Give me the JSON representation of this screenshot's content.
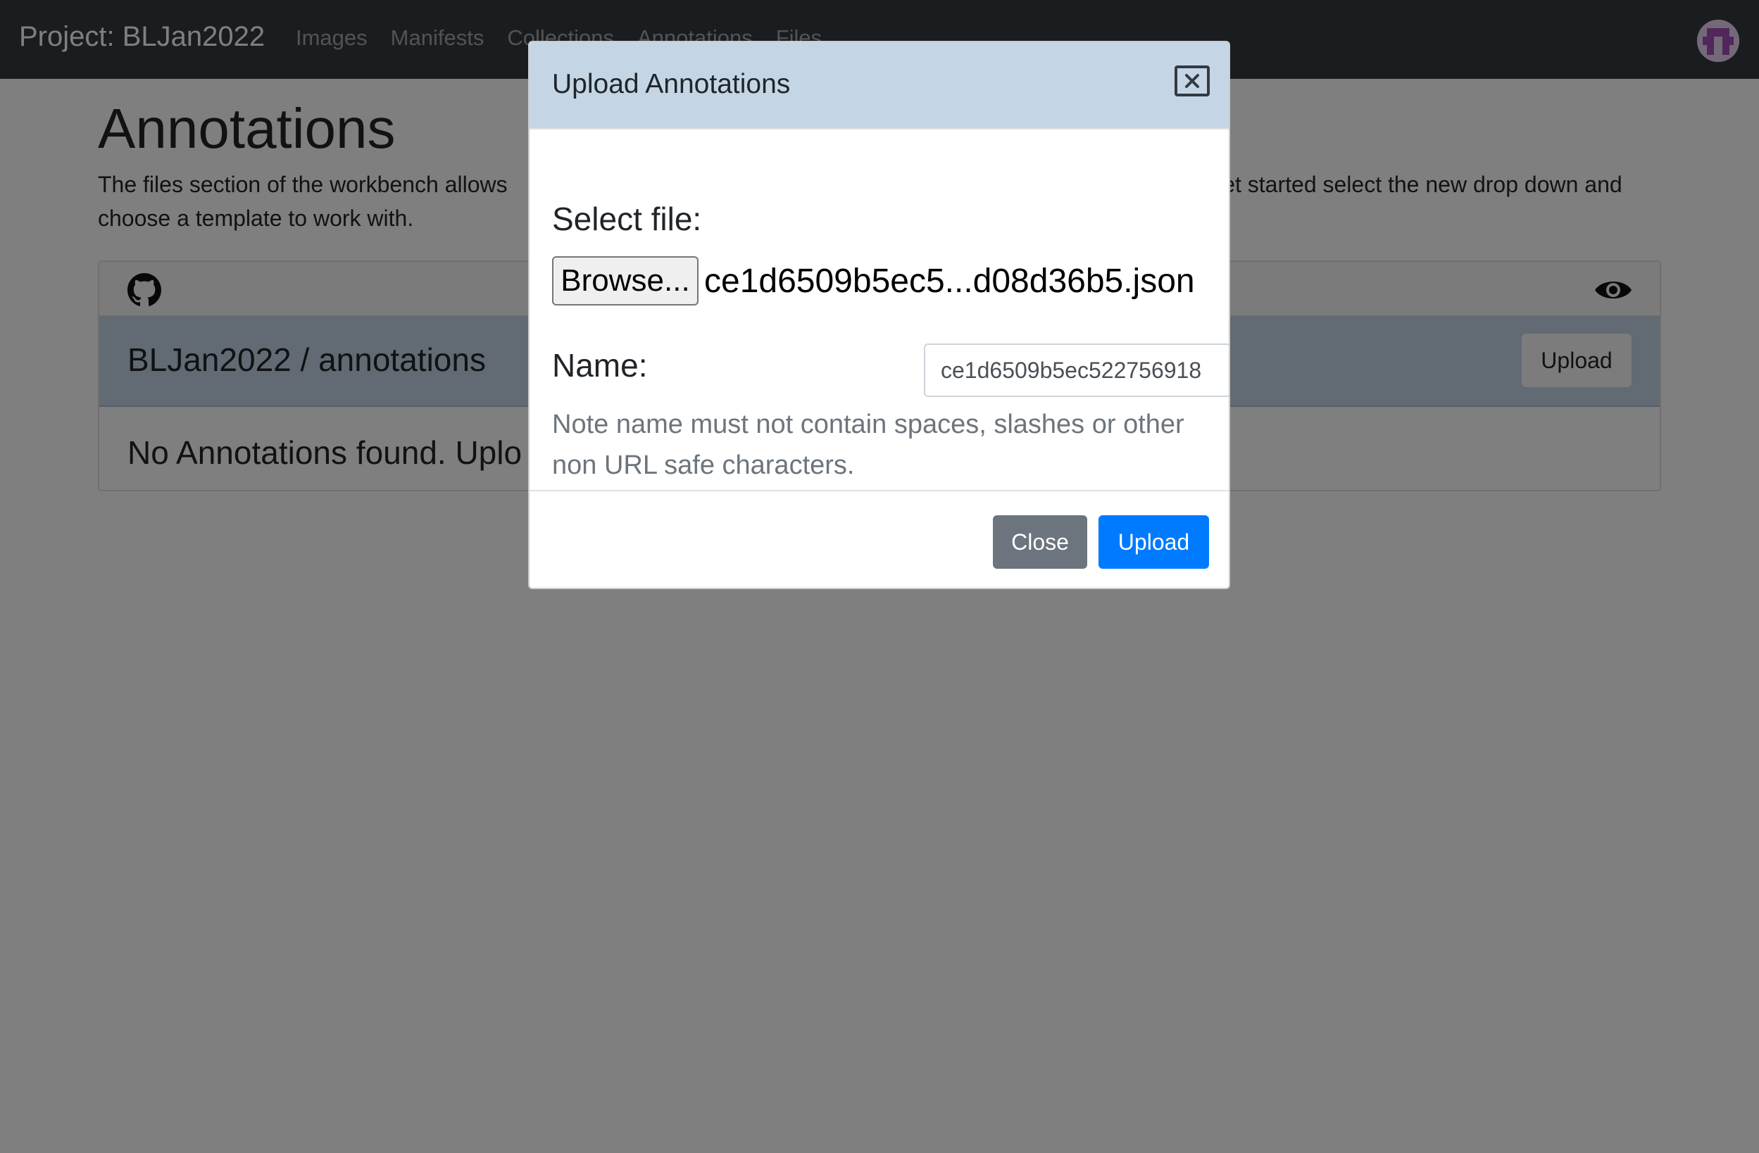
{
  "navbar": {
    "brand": "Project: BLJan2022",
    "links": [
      "Images",
      "Manifests",
      "Collections",
      "Annotations",
      "Files"
    ]
  },
  "main": {
    "title": "Annotations",
    "intro_left": "The files section of the workbench allows",
    "intro_right": "get started select the new drop down and",
    "intro_line2": "choose a template to work with."
  },
  "card": {
    "repo_title": "BLJan2022 / annotations",
    "upload_label": "Upload",
    "empty_message": "No Annotations found. Uplo"
  },
  "modal": {
    "title": "Upload Annotations",
    "select_file_label": "Select file:",
    "browse_label": "Browse...",
    "file_name": "ce1d6509b5ec5...d08d36b5.json",
    "name_label": "Name:",
    "name_value": "ce1d6509b5ec522756918",
    "help_text": "Note name must not contain spaces, slashes or other non URL safe characters.",
    "close_label": "Close",
    "upload_label": "Upload"
  },
  "colors": {
    "navbar": "#343a40",
    "header_tint": "#c4d6e6",
    "primary": "#007bff",
    "secondary": "#6c757d"
  }
}
